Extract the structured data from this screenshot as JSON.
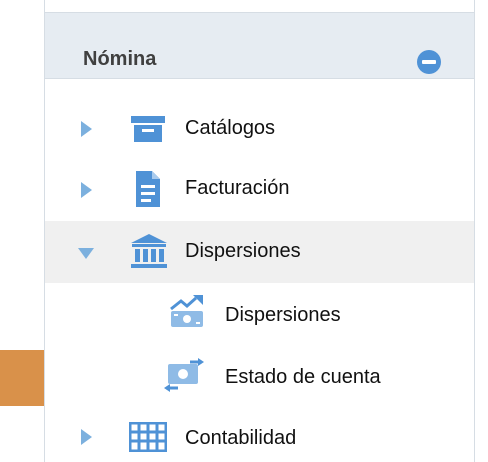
{
  "panel": {
    "title": "Nómina",
    "collapse_icon": "minus-circle-icon"
  },
  "menu": {
    "catalogos": {
      "label": "Catálogos",
      "icon": "archive-box-icon"
    },
    "facturacion": {
      "label": "Facturación",
      "icon": "invoice-document-icon"
    },
    "dispersiones": {
      "label": "Dispersiones",
      "icon": "bank-icon"
    },
    "sub_dispersiones": {
      "label": "Dispersiones",
      "icon": "money-transfer-icon"
    },
    "sub_estado": {
      "label": "Estado de cuenta",
      "icon": "account-statement-icon"
    },
    "contabilidad": {
      "label": "Contabilidad",
      "icon": "ledger-icon"
    }
  },
  "colors": {
    "accent": "#4f92d6",
    "header_bg": "#e6ecf2",
    "active_bg": "#f0f0f0",
    "callout": "#d9914a"
  }
}
